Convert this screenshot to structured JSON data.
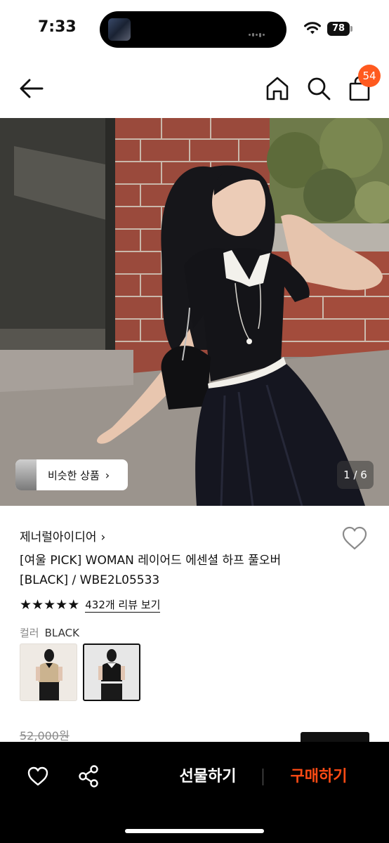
{
  "status_bar": {
    "time": "7:33",
    "battery": "78"
  },
  "nav": {
    "cart_count": "54"
  },
  "hero": {
    "similar_label": "비슷한 상품",
    "similar_chevron": "›",
    "page_indicator": "1 / 6"
  },
  "product": {
    "brand": "제너럴아이디어",
    "brand_chevron": "›",
    "title": "[여울 PICK] WOMAN 레이어드 에센셜 하프 풀오버 [BLACK] / WBE2L05533",
    "rating_stars": 5,
    "review_link": "432개 리뷰 보기",
    "color_label": "컬러",
    "color_value": "BLACK",
    "original_price": "52,000원"
  },
  "bottom_bar": {
    "gift_label": "선물하기",
    "buy_label": "구매하기"
  },
  "colors": {
    "accent": "#ff5a1f",
    "buy": "#ff4b14",
    "bar_bg": "#000000"
  }
}
